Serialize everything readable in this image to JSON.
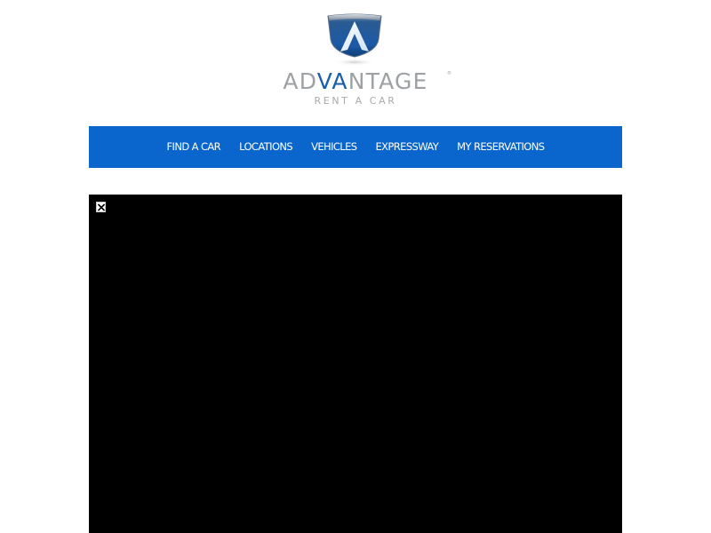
{
  "brand": {
    "name": "ADVANTAGE",
    "tagline": "RENT A CAR",
    "registered_mark": "®",
    "colors": {
      "accent_blue": "#1a5ea8",
      "wordmark_gray": "#9ea1a4",
      "tagline_gray": "#a7a9ab"
    }
  },
  "nav": {
    "background": "#0a66cc",
    "items": [
      {
        "label": "FIND A CAR"
      },
      {
        "label": "LOCATIONS"
      },
      {
        "label": "VEHICLES"
      },
      {
        "label": "EXPRESSWAY"
      },
      {
        "label": "MY RESERVATIONS"
      }
    ]
  },
  "media": {
    "background": "#000000",
    "close_icon": "close-icon"
  }
}
